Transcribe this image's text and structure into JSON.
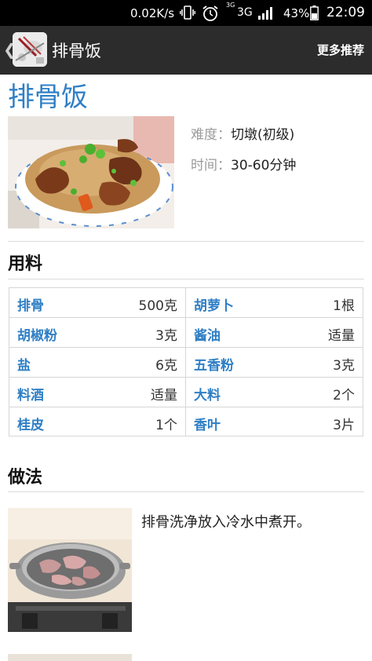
{
  "status_bar": {
    "net_speed": "0.02K/s",
    "network_small": "3G",
    "network": "3G",
    "battery": "43%",
    "time": "22:09"
  },
  "action_bar": {
    "title": "排骨饭",
    "more": "更多推荐"
  },
  "recipe": {
    "title": "排骨饭",
    "difficulty_label": "难度：",
    "difficulty": "切墩(初级)",
    "time_label": "时间：",
    "time": "30-60分钟"
  },
  "ingredients": {
    "heading": "用料",
    "rows": [
      [
        {
          "name": "排骨",
          "qty": "500克"
        },
        {
          "name": "胡萝卜",
          "qty": "1根"
        }
      ],
      [
        {
          "name": "胡椒粉",
          "qty": "3克"
        },
        {
          "name": "酱油",
          "qty": "适量"
        }
      ],
      [
        {
          "name": "盐",
          "qty": "6克"
        },
        {
          "name": "五香粉",
          "qty": "3克"
        }
      ],
      [
        {
          "name": "料酒",
          "qty": "适量"
        },
        {
          "name": "大料",
          "qty": "2个"
        }
      ],
      [
        {
          "name": "桂皮",
          "qty": "1个"
        },
        {
          "name": "香叶",
          "qty": "3片"
        }
      ]
    ]
  },
  "steps": {
    "heading": "做法",
    "items": [
      {
        "text": "排骨洗净放入冷水中煮开。"
      }
    ]
  },
  "colors": {
    "accent": "#2f7fc5",
    "action_bar": "#2c2c2c",
    "status_bar": "#000000"
  }
}
